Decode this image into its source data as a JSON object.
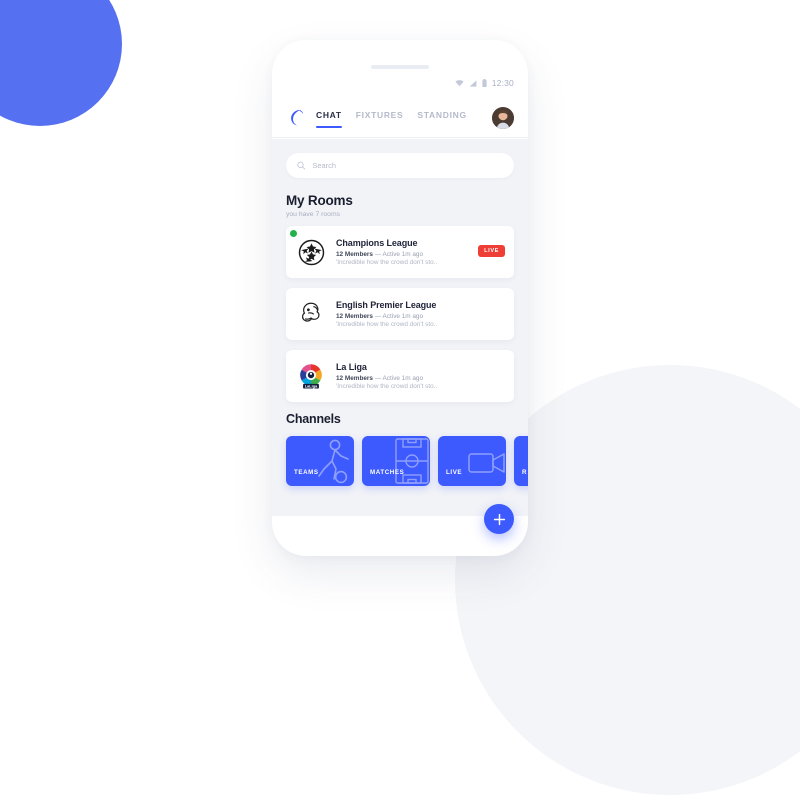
{
  "theme": {
    "accent_blue": "#3d5afe",
    "decor_blue": "#5570f1",
    "decor_gray": "#f4f5f8",
    "live_red": "#ef3e36",
    "online_green": "#22b24c",
    "screen_bg": "#f2f3f7"
  },
  "statusbar": {
    "time": "12:30",
    "icons": [
      "wifi-icon",
      "signal-icon",
      "battery-icon"
    ]
  },
  "navbar": {
    "logo": "crescent-logo-icon",
    "avatar": "user-avatar",
    "tabs": [
      {
        "label": "CHAT",
        "active": true
      },
      {
        "label": "FIXTURES",
        "active": false
      },
      {
        "label": "STANDING",
        "active": false
      }
    ]
  },
  "search": {
    "placeholder": "Search",
    "value": "",
    "icon": "search-icon"
  },
  "my_rooms": {
    "title": "My Rooms",
    "subtitle": "you have 7 rooms",
    "rooms": [
      {
        "name": "Champions League",
        "members": "12 Members",
        "separator": " — ",
        "activity": "Active 1m ago",
        "snippet": "'Incredible how the crowd don't sto..",
        "badge": "LIVE",
        "online": true,
        "logo": "champions-league-logo"
      },
      {
        "name": "English Premier League",
        "members": "12 Members",
        "separator": " — ",
        "activity": "Active 1m ago",
        "snippet": "'Incredible how the crowd don't sto..",
        "badge": "",
        "online": false,
        "logo": "premier-league-logo"
      },
      {
        "name": "La Liga",
        "members": "12 Members",
        "separator": " — ",
        "activity": "Active 1m ago",
        "snippet": "'Incredible how the crowd don't sto..",
        "badge": "",
        "online": false,
        "logo": "la-liga-logo"
      }
    ]
  },
  "channels": {
    "title": "Channels",
    "items": [
      {
        "label": "TEAMS",
        "art": "soccer-player-icon"
      },
      {
        "label": "MATCHES",
        "art": "pitch-icon"
      },
      {
        "label": "LIVE",
        "art": "video-camera-icon"
      },
      {
        "label": "R",
        "art": "partial-icon"
      }
    ]
  },
  "fab": {
    "label": "+",
    "icon": "plus-icon"
  }
}
